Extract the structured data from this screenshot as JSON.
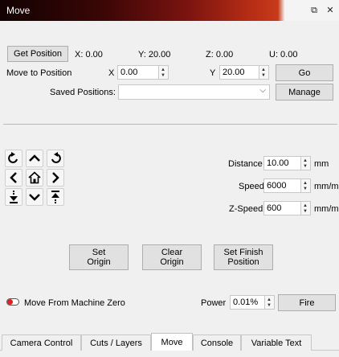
{
  "window": {
    "title": "Move",
    "restore_symbol": "⧉",
    "close_symbol": "✕"
  },
  "position": {
    "get_button": "Get Position",
    "x": "X: 0.00",
    "y": "Y: 20.00",
    "z": "Z: 0.00",
    "u": "U: 0.00"
  },
  "move_to": {
    "label": "Move to Position",
    "x_label": "X",
    "x_value": "0.00",
    "y_label": "Y",
    "y_value": "20.00",
    "go_button": "Go"
  },
  "saved": {
    "label": "Saved Positions:",
    "selected": "",
    "manage_button": "Manage"
  },
  "jog": {
    "buttons": [
      "rotate-ccw",
      "up",
      "up-left",
      "rotate-cw",
      "left",
      "home",
      "right",
      "down-to-bottom",
      "down",
      "up-to-top"
    ]
  },
  "settings": {
    "distance_label": "Distance",
    "distance_value": "10.00",
    "distance_unit": "mm",
    "speed_label": "Speed",
    "speed_value": "6000",
    "speed_unit": "mm/m",
    "zspeed_label": "Z-Speed",
    "zspeed_value": "600",
    "zspeed_unit": "mm/m"
  },
  "origin": {
    "set_origin_line1": "Set",
    "set_origin_line2": "Origin",
    "clear_origin_line1": "Clear",
    "clear_origin_line2": "Origin",
    "set_finish_line1": "Set Finish",
    "set_finish_line2": "Position"
  },
  "bottom": {
    "machine_zero_label": "Move From Machine Zero",
    "power_label": "Power",
    "power_value": "0.01%",
    "fire_button": "Fire"
  },
  "tabs": [
    "Camera Control",
    "Cuts / Layers",
    "Move",
    "Console",
    "Variable Text"
  ],
  "active_tab": "Move",
  "colors": {
    "accent": "#c83a1a",
    "toggle_knob": "#dd2222"
  }
}
